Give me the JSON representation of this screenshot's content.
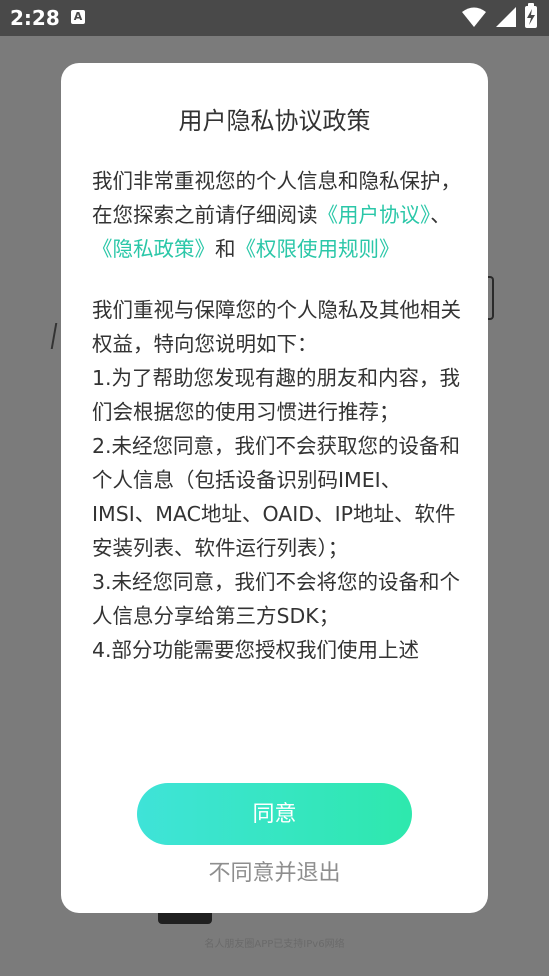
{
  "status_bar": {
    "time": "2:28",
    "notification_icon": "A",
    "icons": [
      "wifi-icon",
      "signal-icon",
      "battery-charging-icon"
    ]
  },
  "background": {
    "footnote": "名人朋友圈APP已支持IPv6网络"
  },
  "dialog": {
    "title": "用户隐私协议政策",
    "intro": {
      "text_before": "我们非常重视您的个人信息和隐私保护，在您探索之前请仔细阅读",
      "link_user_agreement": "《用户协议》",
      "sep": "、",
      "link_privacy_policy": "《隐私政策》",
      "and": "和",
      "link_permission_rules": "《权限使用规则》"
    },
    "body_lead": "我们重视与保障您的个人隐私及其他相关权益，特向您说明如下：",
    "items": [
      "1.为了帮助您发现有趣的朋友和内容，我们会根据您的使用习惯进行推荐；",
      "2.未经您同意，我们不会获取您的设备和个人信息（包括设备识别码IMEI、IMSI、MAC地址、OAID、IP地址、软件安装列表、软件运行列表）；",
      "3.未经您同意，我们不会将您的设备和个人信息分享给第三方SDK；",
      "4.部分功能需要您授权我们使用上述"
    ],
    "agree_label": "同意",
    "disagree_label": "不同意并退出"
  },
  "colors": {
    "link": "#2bc7a8",
    "button_gradient_start": "#3fe3d8",
    "button_gradient_end": "#2ee8ad",
    "overlay": "#7b7b7b",
    "status_bar": "#494949"
  }
}
